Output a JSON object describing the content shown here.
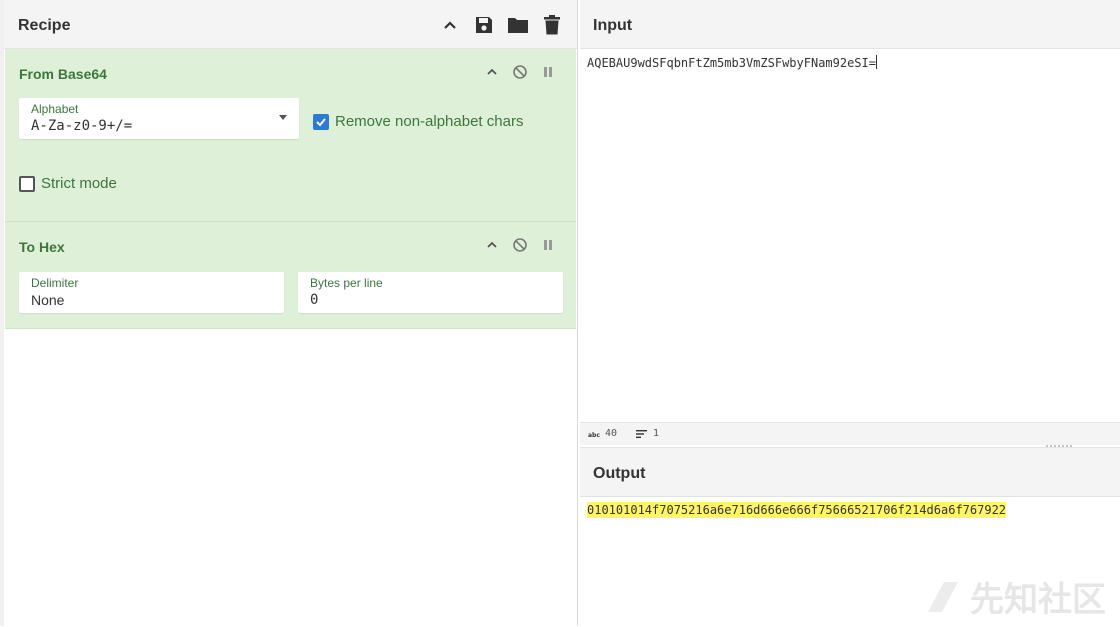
{
  "recipe": {
    "title": "Recipe",
    "header_icons": [
      "chevron-up-icon",
      "save-icon",
      "folder-icon",
      "trash-icon"
    ],
    "operations": [
      {
        "title": "From Base64",
        "alphabet_label": "Alphabet",
        "alphabet_value": "A-Za-z0-9+/=",
        "remove_non_alpha_label": "Remove non-alphabet chars",
        "remove_non_alpha_checked": true,
        "strict_mode_label": "Strict mode",
        "strict_mode_checked": false
      },
      {
        "title": "To Hex",
        "delimiter_label": "Delimiter",
        "delimiter_value": "None",
        "bytes_per_line_label": "Bytes per line",
        "bytes_per_line_value": "0"
      }
    ]
  },
  "input": {
    "title": "Input",
    "text": "AQEBAU9wdSFqbnFtZm5mb3VmZSFwbyFNam92eSI=",
    "status_length": "40",
    "status_lines": "1"
  },
  "output": {
    "title": "Output",
    "text": "010101014f7075216a6e716d666e666f75666521706f214d6a6f767922"
  },
  "watermark": {
    "text": "先知社区"
  },
  "colors": {
    "op_background": "#dff0d8",
    "op_title": "#3c763d",
    "checkbox_accent": "#2b7bd6",
    "output_highlight": "#fff566"
  }
}
